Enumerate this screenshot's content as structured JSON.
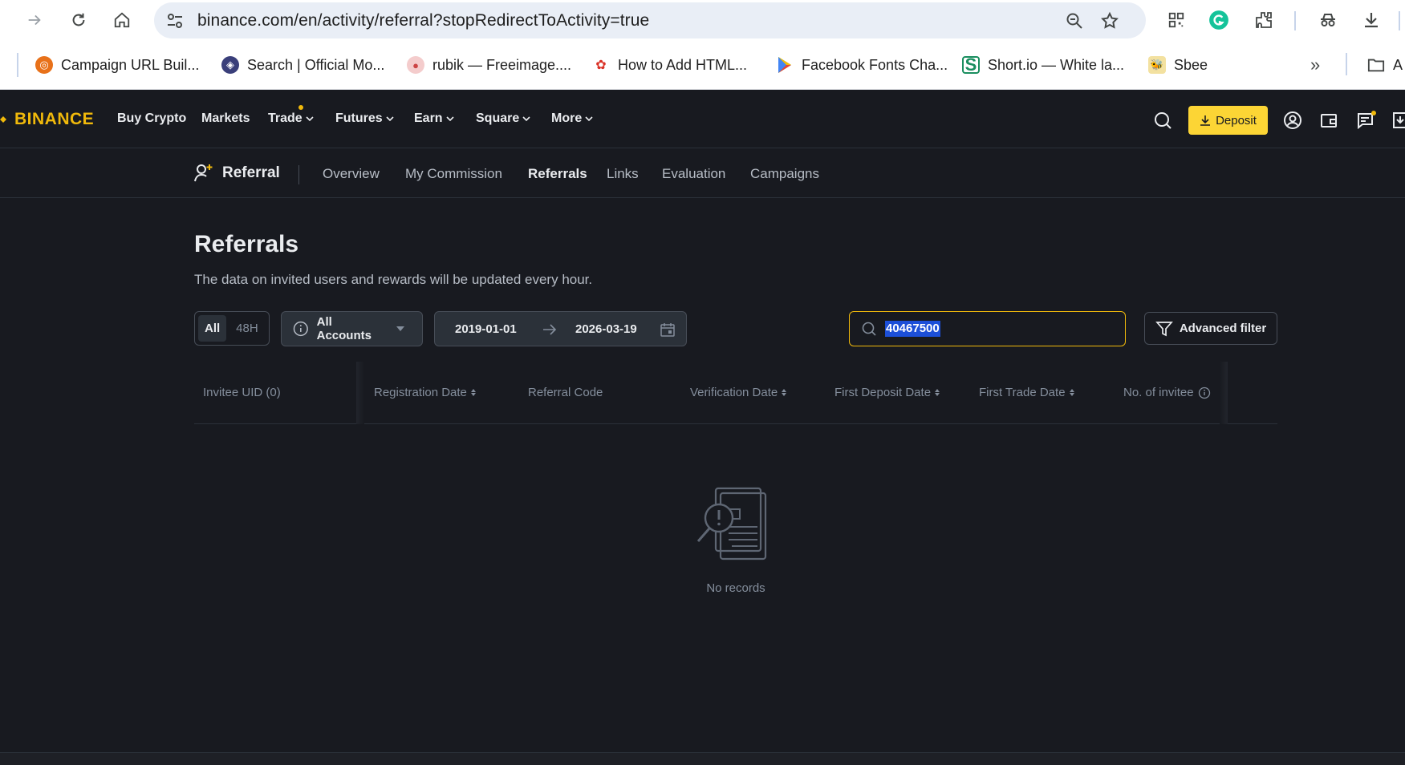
{
  "browser": {
    "url": "binance.com/en/activity/referral?stopRedirectToActivity=true",
    "bookmarks": [
      {
        "label": "Campaign URL Buil...",
        "color": "#e8711a"
      },
      {
        "label": "Search | Official Mo...",
        "color": "#3a3f7a"
      },
      {
        "label": "rubik — Freeimage....",
        "color": "#e06666"
      },
      {
        "label": "How to Add HTML...",
        "color": "#d93025"
      },
      {
        "label": "Facebook Fonts Cha...",
        "color": "#34a853"
      },
      {
        "label": "Short.io — White la...",
        "color": "#1a8e5f"
      },
      {
        "label": "Sbee",
        "color": "#c9a227"
      },
      {
        "label": "A",
        "color": "#444746"
      }
    ]
  },
  "header": {
    "logo": "BINANCE",
    "menu": [
      {
        "label": "Buy Crypto"
      },
      {
        "label": "Markets"
      },
      {
        "label": "Trade"
      },
      {
        "label": "Futures"
      },
      {
        "label": "Earn"
      },
      {
        "label": "Square"
      },
      {
        "label": "More"
      }
    ],
    "deposit_label": "Deposit",
    "brand_color": "#f0b90b",
    "deposit_color": "#fcd535"
  },
  "subnav": {
    "brand": "Referral",
    "tabs": [
      {
        "label": "Overview"
      },
      {
        "label": "My Commission"
      },
      {
        "label": "Referrals"
      },
      {
        "label": "Links"
      },
      {
        "label": "Evaluation"
      },
      {
        "label": "Campaigns"
      }
    ],
    "active_tab": "Referrals"
  },
  "page": {
    "title": "Referrals",
    "subtitle": "The data on invited users and rewards will be updated every hour."
  },
  "filters": {
    "period": [
      "All",
      "48H"
    ],
    "period_selected": "All",
    "account": "All Accounts",
    "date_from": "2019-01-01",
    "date_to": "2026-03-19",
    "search_value": "40467500",
    "advanced_label": "Advanced filter"
  },
  "table": {
    "columns": [
      {
        "label": "Invitee UID (0)"
      },
      {
        "label": "Registration Date"
      },
      {
        "label": "Referral Code"
      },
      {
        "label": "Verification Date"
      },
      {
        "label": "First Deposit Date"
      },
      {
        "label": "First Trade Date"
      },
      {
        "label": "No. of invitee"
      }
    ],
    "rows": [],
    "empty_text": "No records"
  }
}
